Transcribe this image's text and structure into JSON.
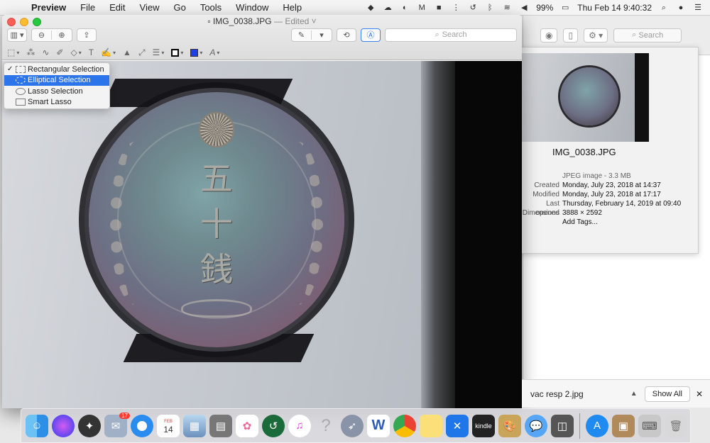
{
  "menubar": {
    "app": "Preview",
    "items": [
      "File",
      "Edit",
      "View",
      "Go",
      "Tools",
      "Window",
      "Help"
    ],
    "battery": "99%",
    "clock": "Thu Feb 14  9:40:32"
  },
  "window": {
    "title": "IMG_0038.JPG",
    "edited": "— Edited ˅",
    "search_placeholder": "Search"
  },
  "selection_menu": {
    "items": [
      {
        "label": "Rectangular Selection",
        "checked": true
      },
      {
        "label": "Elliptical Selection",
        "highlighted": true
      },
      {
        "label": "Lasso Selection"
      },
      {
        "label": "Smart Lasso"
      }
    ]
  },
  "coin": {
    "kanji": [
      "五",
      "十",
      "銭"
    ]
  },
  "info_panel": {
    "filename": "IMG_0038.JPG",
    "kind": "JPEG image - 3.3 MB",
    "rows": [
      {
        "k": "Created",
        "v": "Monday, July 23, 2018 at 14:37"
      },
      {
        "k": "Modified",
        "v": "Monday, July 23, 2018 at 17:17"
      },
      {
        "k": "Last opened",
        "v": "Thursday, February 14, 2019 at 09:40"
      },
      {
        "k": "Dimensions",
        "v": "3888 × 2592"
      }
    ],
    "add_tags": "Add Tags..."
  },
  "background_window": {
    "search_placeholder": "Search"
  },
  "download_bar": {
    "file": "vac resp 2.jpg",
    "show_all": "Show All"
  },
  "dock": {
    "icons": [
      "finder-icon",
      "siri-icon",
      "launchpad-icon",
      "photos-preview-icon",
      "safari-icon",
      "calendar-icon",
      "preview-icon",
      "calculator-icon",
      "photos-icon",
      "time-machine-icon",
      "itunes-icon",
      "help-icon",
      "rocket-icon",
      "word-icon",
      "chrome-icon",
      "notes-icon",
      "xcode-icon",
      "kindle-icon",
      "art-icon",
      "messages-icon",
      "photo-booth-icon",
      "appstore-icon",
      "image-icon",
      "keyboard-icon",
      "trash-icon"
    ],
    "calendar_day": "14",
    "calendar_month": "FEB",
    "mail_badge": "17",
    "kindle_label": "kindle"
  }
}
